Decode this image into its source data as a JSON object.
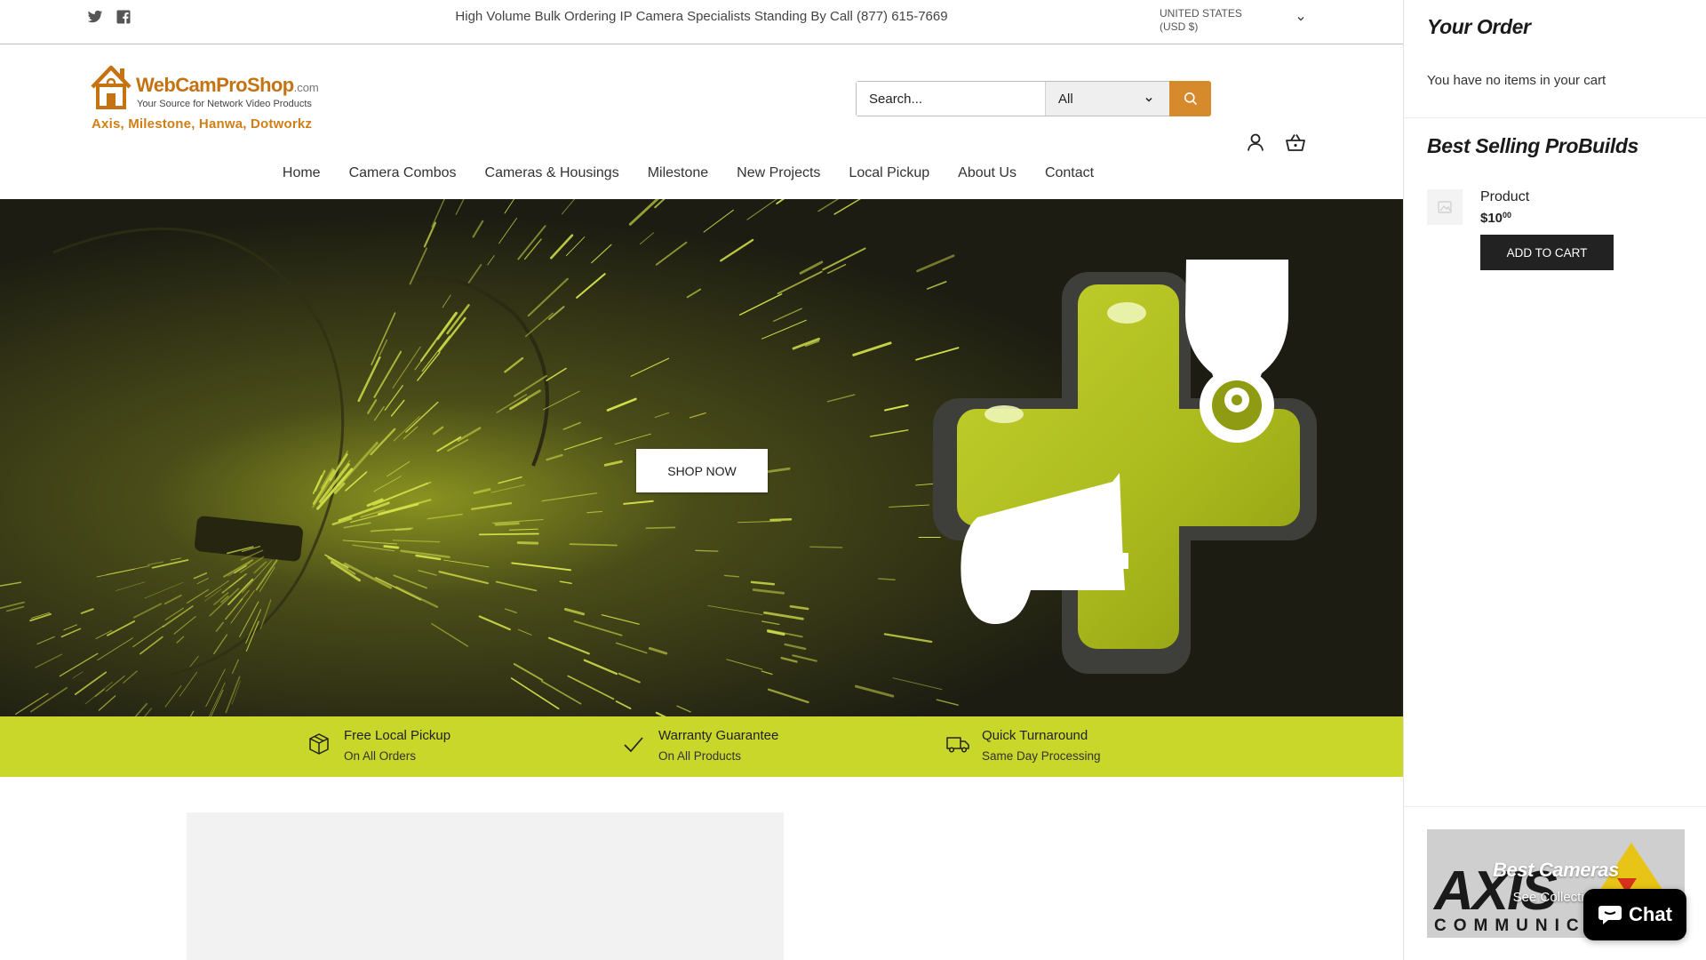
{
  "announcement": "High Volume Bulk Ordering IP Camera Specialists Standing By Call (877) 615-7669",
  "country_selector": {
    "line1": "UNITED STATES",
    "line2": "(USD $)"
  },
  "social": [
    "twitter-icon",
    "facebook-icon"
  ],
  "logo": {
    "brand": "WebCamProShop",
    "brand_suffix": ".com",
    "tagline": "Your Source for Network Video Products",
    "brands_line": "Axis, Milestone, Hanwa, Dotworkz"
  },
  "search": {
    "placeholder": "Search...",
    "category": "All"
  },
  "nav": [
    "Home",
    "Camera Combos",
    "Cameras & Housings",
    "Milestone",
    "New Projects",
    "Local Pickup",
    "About Us",
    "Contact"
  ],
  "hero": {
    "cta": "SHOP NOW"
  },
  "features": [
    {
      "icon": "box-icon",
      "title": "Free Local Pickup",
      "subtitle": "On All Orders"
    },
    {
      "icon": "checkmark-icon",
      "title": "Warranty Guarantee",
      "subtitle": "On All Products"
    },
    {
      "icon": "truck-icon",
      "title": "Quick Turnaround",
      "subtitle": "Same Day Processing"
    }
  ],
  "drawer": {
    "title": "Your Order",
    "empty_message": "You have no items in your cart",
    "best_selling_title": "Best Selling ProBuilds",
    "product": {
      "title": "Product",
      "price_main": "$10",
      "price_cents": "00",
      "button": "ADD TO CART"
    },
    "collection": {
      "title": "Best Cameras",
      "link": "See Collection",
      "logo_text_top": "AXIS",
      "logo_text_bottom": "COMMUNICATIONS"
    }
  },
  "chat": {
    "label": "Chat"
  },
  "colors": {
    "accent_lime": "#c9d62a",
    "search_button": "#d68a2c",
    "logo_orange": "#c57312",
    "button_dark": "#222222"
  }
}
